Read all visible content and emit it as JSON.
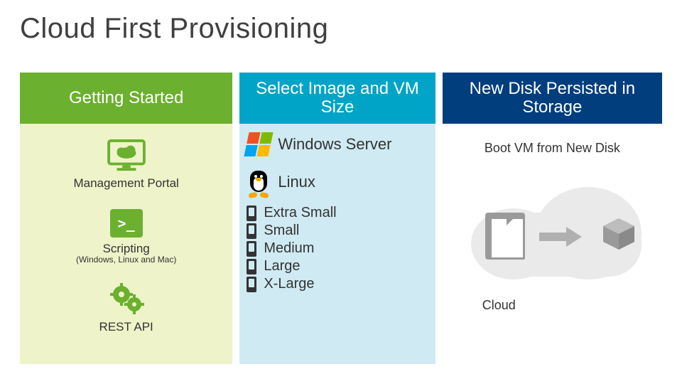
{
  "title": "Cloud First Provisioning",
  "columns": {
    "col1": {
      "header": "Getting Started",
      "items": {
        "portal": "Management Portal",
        "scripting": {
          "label": "Scripting",
          "sub": "(Windows, Linux and Mac)"
        },
        "rest": "REST API"
      }
    },
    "col2": {
      "header": "Select Image and VM Size",
      "os": {
        "windows": "Windows Server",
        "linux": "Linux"
      },
      "sizes": [
        "Extra Small",
        "Small",
        "Medium",
        "Large",
        "X-Large"
      ]
    },
    "col3": {
      "header": "New Disk Persisted in Storage",
      "boot": "Boot VM from New Disk",
      "cloud": "Cloud"
    }
  },
  "colors": {
    "green": "#6bb02e",
    "cyan": "#00a4c6",
    "navy": "#003e7e",
    "lime_bg": "#eef3c9",
    "cyan_bg": "#cfeaf2"
  }
}
